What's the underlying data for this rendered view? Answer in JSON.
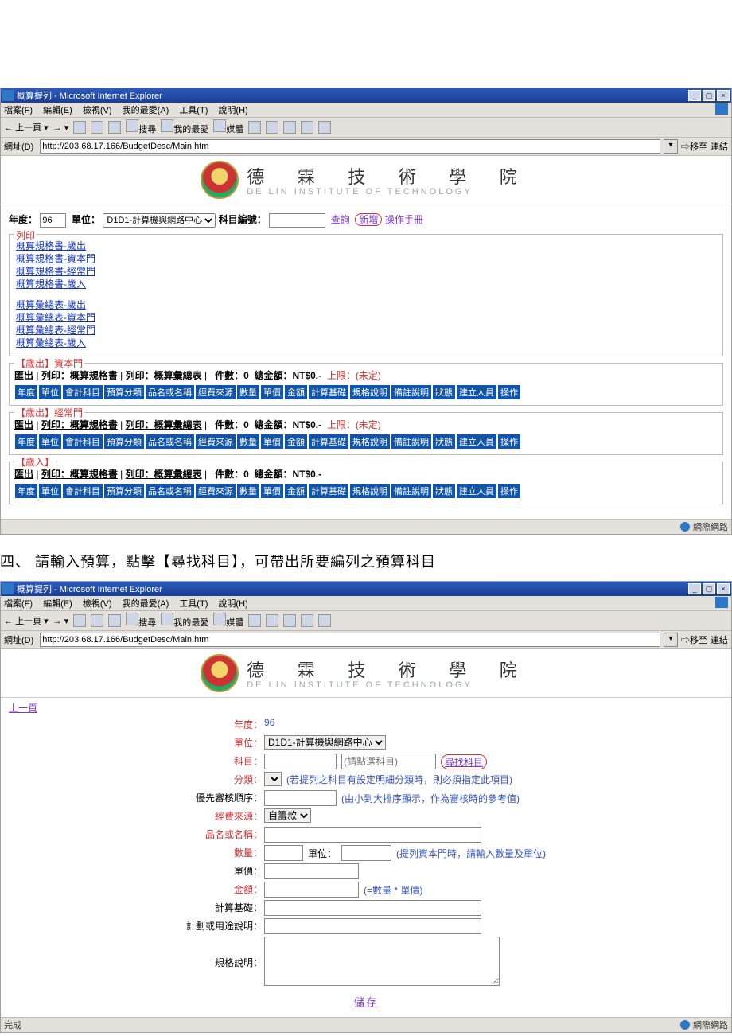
{
  "instruction_text": "四、 請輸入預算，點擊【尋找科目】，可帶出所要編列之預算科目",
  "ie": {
    "title": "概算提列 - Microsoft Internet Explorer",
    "menu": {
      "file": "檔案(F)",
      "edit": "編輯(E)",
      "view": "檢視(V)",
      "fav": "我的最愛(A)",
      "tools": "工具(T)",
      "help": "說明(H)"
    },
    "toolbar": {
      "back": "上一頁",
      "search": "搜尋",
      "fav": "我的最愛",
      "media": "媒體"
    },
    "addr_label": "網址(D)",
    "addr_value": "http://203.68.17.166/BudgetDesc/Main.htm",
    "go": "移至",
    "links": "連結",
    "status_done": "完成",
    "status_right": "網際網路"
  },
  "banner": {
    "cn": "德 霖 技 術 學 院",
    "en": "DE LIN  INSTITUTE OF TECHNOLOGY"
  },
  "screen1": {
    "filter": {
      "year_label": "年度：",
      "year_value": "96",
      "unit_label": "單位：",
      "unit_value": "D1D1-計算機與網路中心",
      "subj_label": "科目編號：",
      "query": "查詢",
      "add": "新增",
      "manual": "操作手冊"
    },
    "print": {
      "legend": "列印",
      "links1": [
        "概算規格書-歲出",
        "概算規格書-資本門",
        "概算規格書-經常門",
        "概算規格書-歲入"
      ],
      "links2": [
        "概算彙總表-歲出",
        "概算彙總表-資本門",
        "概算彙總表-經常門",
        "概算彙總表-歲入"
      ]
    },
    "sections": [
      {
        "legend": "【歲出】資本門",
        "head_export": "匯出",
        "head_print1": "列印：概算規格書",
        "head_print2": "列印：概算彙總表",
        "count_label": "件數：",
        "count": "0",
        "amount_label": "總金額：",
        "amount": "NT$0.-",
        "limit_label": "上限：",
        "limit": "(未定)"
      },
      {
        "legend": "【歲出】經常門",
        "head_export": "匯出",
        "head_print1": "列印：概算規格書",
        "head_print2": "列印：概算彙總表",
        "count_label": "件數：",
        "count": "0",
        "amount_label": "總金額：",
        "amount": "NT$0.-",
        "limit_label": "上限：",
        "limit": "(未定)"
      },
      {
        "legend": "【歲入】",
        "head_export": "匯出",
        "head_print1": "列印：概算規格書",
        "head_print2": "列印：概算彙總表",
        "count_label": "件數：",
        "count": "0",
        "amount_label": "總金額：",
        "amount": "NT$0.-",
        "limit_label": "",
        "limit": ""
      }
    ],
    "headers": [
      "年度",
      "單位",
      "會計科目",
      "預算分類",
      "品名或名稱",
      "經費來源",
      "數量",
      "單價",
      "金額",
      "計算基礎",
      "規格說明",
      "備註說明",
      "狀態",
      "建立人員",
      "操作"
    ]
  },
  "screen2": {
    "prev": "上一頁",
    "rows": {
      "year": {
        "label": "年度：",
        "value": "96"
      },
      "unit": {
        "label": "單位：",
        "value": "D1D1-計算機與網路中心"
      },
      "subj": {
        "label": "科目：",
        "placeholder": "(請點選科目)",
        "btn": "尋找科目"
      },
      "class": {
        "label": "分類：",
        "hint": "(若提列之科目有設定明細分類時，則必須指定此項目)"
      },
      "priority": {
        "label": "優先審核順序：",
        "hint": "(由小到大排序顯示，作為審核時的參考值)"
      },
      "fund": {
        "label": "經費來源：",
        "value": "自籌款"
      },
      "name": {
        "label": "品名或名稱："
      },
      "qty": {
        "label": "數量：",
        "unit_label": "單位：",
        "hint": "(提列資本門時，請輸入數量及單位)"
      },
      "price": {
        "label": "單價："
      },
      "amount": {
        "label": "金額：",
        "hint": "(=數量 * 單價)"
      },
      "basis": {
        "label": "計算基礎："
      },
      "plan": {
        "label": "計劃或用途說明："
      },
      "spec": {
        "label": "規格說明："
      }
    },
    "save": "儲存"
  }
}
